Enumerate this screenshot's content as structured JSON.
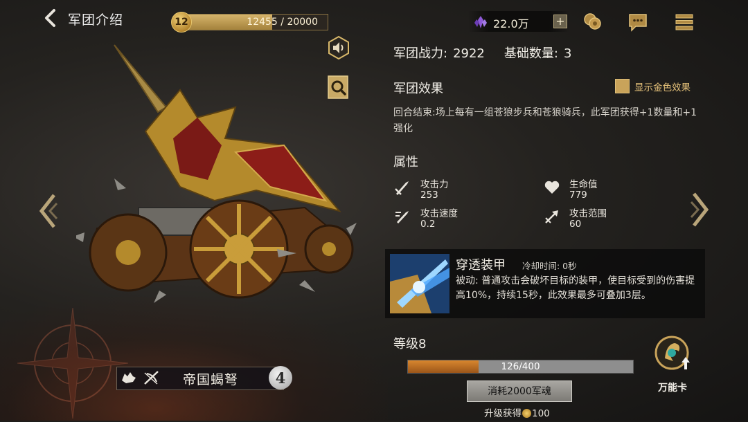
{
  "header": {
    "title": "军团介绍",
    "player_level": "12",
    "xp_text": "12455 / 20000",
    "xp_progress": 0.62,
    "currency_amount": "22.0万",
    "plus_label": "+"
  },
  "unit": {
    "name": "帝国蝎弩",
    "quantity": "4"
  },
  "stats": {
    "power_label": "军团战力:",
    "power_value": "2922",
    "base_label": "基础数量:",
    "base_value": "3"
  },
  "effect": {
    "title": "军团效果",
    "gold_toggle_label": "显示金色效果",
    "text": "回合结束:场上每有一组苍狼步兵和苍狼骑兵，此军团获得+1数量和+1强化"
  },
  "attributes": {
    "title": "属性",
    "items": [
      {
        "name": "攻击力",
        "value": "253",
        "icon": "sword-icon"
      },
      {
        "name": "生命值",
        "value": "779",
        "icon": "heart-icon"
      },
      {
        "name": "攻击速度",
        "value": "0.2",
        "icon": "attack-speed-icon"
      },
      {
        "name": "攻击范围",
        "value": "60",
        "icon": "range-arrow-icon"
      }
    ]
  },
  "skill": {
    "name": "穿透装甲",
    "cooldown": "冷却时间: 0秒",
    "description": "被动: 普通攻击会破坏目标的装甲，使目标受到的伤害提高10%，持续15秒，此效果最多可叠加3层。"
  },
  "upgrade": {
    "grade": "等级8",
    "progress_text": "126/400",
    "progress": 0.315,
    "consume_label": "消耗2000军魂",
    "reward_prefix": "升级获得",
    "reward_amount": "100",
    "wild_card_label": "万能卡"
  },
  "colors": {
    "accent_gold": "#c9a35a",
    "progress_orange": "#d8862e"
  }
}
